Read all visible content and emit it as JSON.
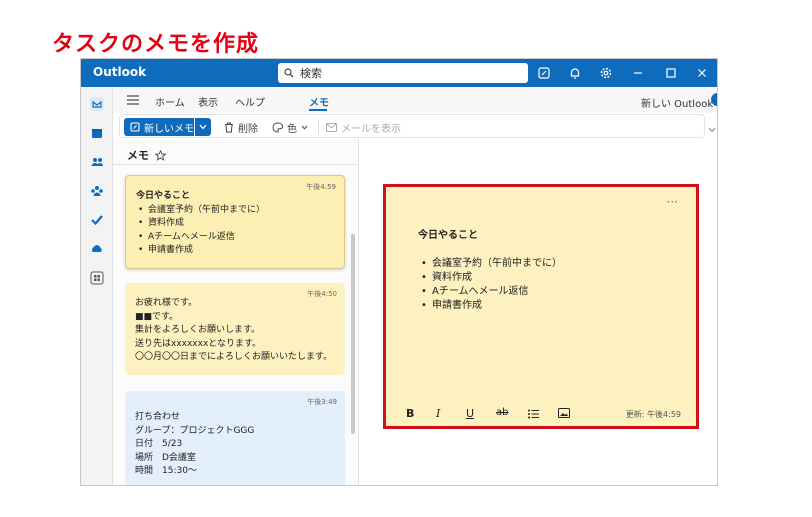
{
  "page_heading": "タスクのメモを作成",
  "window": {
    "app_title": "Outlook",
    "search_placeholder": "検索"
  },
  "menu": {
    "items": [
      "ホーム",
      "表示",
      "ヘルプ",
      "メモ"
    ],
    "toggle_label": "新しい Outlook"
  },
  "toolbar": {
    "new_note": "新しいメモ",
    "delete": "削除",
    "color": "色",
    "show_in_mail": "メールを表示"
  },
  "list": {
    "header": "メモ",
    "notes": [
      {
        "time": "午後4:59",
        "title": "今日やること",
        "bullets": [
          "会議室予約（午前中までに）",
          "資料作成",
          "Aチームへメール返信",
          "申請書作成"
        ]
      },
      {
        "time": "午後4:50",
        "lines": [
          "お疲れ様です。",
          "■■です。",
          "集計をよろしくお願いします。",
          "送り先はxxxxxxxとなります。",
          "〇〇月〇〇日までによろしくお願いいたします。"
        ]
      },
      {
        "time": "午後3:49",
        "lines": [
          "打ち合わせ",
          "グループ：プロジェクトGGG",
          "日付　5/23",
          "場所　D会議室",
          "時間　15:30〜"
        ]
      }
    ]
  },
  "editor": {
    "more": "···",
    "title": "今日やること",
    "bullets": [
      "会議室予約（午前中までに）",
      "資料作成",
      "Aチームへメール返信",
      "申請書作成"
    ],
    "format": {
      "bold": "B",
      "italic": "I",
      "underline": "U",
      "strike": "ab"
    },
    "updated": "更新: 午後4:59"
  },
  "colors": {
    "accent": "#0f6cbd",
    "note_yellow": "#fdf1c0",
    "note_blue": "#e3effb",
    "highlight_red": "#d0101a",
    "heading_red": "#e60012"
  }
}
